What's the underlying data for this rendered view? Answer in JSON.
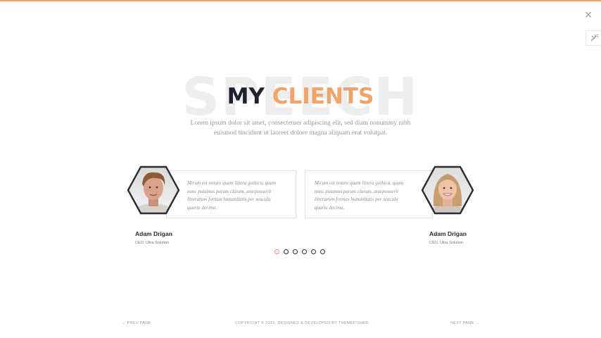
{
  "header": {
    "close_icon": "×",
    "accent_color": "#f0a36a"
  },
  "section": {
    "background_word": "SPEECH",
    "title_part1": "MY",
    "title_part2": "CLIENTS",
    "subtitle": "Lorem ipsum dolor sit amet, consectetuer adipiscing elit, sed diam nonummy nibh euismod tincidunt ut laoreet dolore magna aliquam erat volutpat."
  },
  "testimonials": [
    {
      "quote": "Mirum est notare quam littera gothica, quam nunc putamus parum claram, anteposuerit litterarum formas humanitatis per seacula quarta decima.",
      "name": "Adam Drigan",
      "role": "CEO, Ultra Solution",
      "avatar": "young-man-portrait"
    },
    {
      "quote": "Mirum est notare quam littera gothica, quam nunc putamus parum claram, anteposuerit litterarum formas humanitatis per seacula quarta decima.",
      "name": "Adam Drigan",
      "role": "CEO, Ultra Solution",
      "avatar": "smiling-woman-portrait"
    }
  ],
  "pagination": {
    "count": 6,
    "active_index": 0
  },
  "footer": {
    "prev": "← PREV PAGE",
    "copyright": "COPYRIGHT © 2021, DESIGNED & DEVELOPED BY THEMEFISHER.",
    "next": "NEXT PAGE →"
  }
}
